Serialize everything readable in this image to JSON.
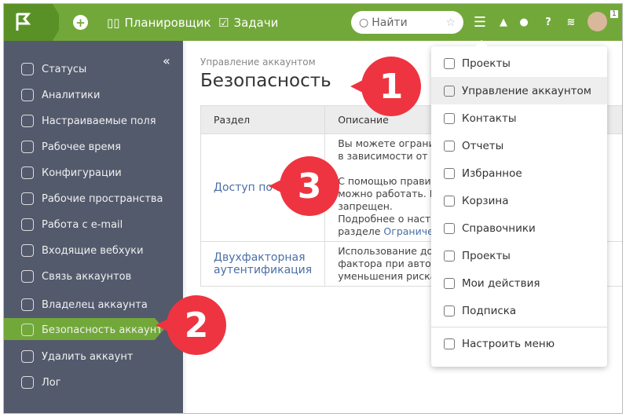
{
  "topbar": {
    "planner": "Планировщик",
    "tasks": "Задачи",
    "search_placeholder": "Найти",
    "notif_count": "1"
  },
  "sidebar": {
    "collapse": "«",
    "items": [
      {
        "label": "Статусы"
      },
      {
        "label": "Аналитики"
      },
      {
        "label": "Настраиваемые поля"
      },
      {
        "label": "Рабочее время"
      },
      {
        "label": "Конфигурации"
      },
      {
        "label": "Рабочие пространства"
      },
      {
        "label": "Работа с e-mail"
      },
      {
        "label": "Входящие вебхуки"
      },
      {
        "label": "Связь аккаунтов"
      },
      {
        "label": "Владелец аккаунта"
      },
      {
        "label": "Безопасность аккаунта"
      },
      {
        "label": "Удалить аккаунт"
      },
      {
        "label": "Лог"
      }
    ]
  },
  "main": {
    "breadcrumb": "Управление аккаунтом",
    "title": "Безопасность",
    "col_section": "Раздел",
    "col_desc": "Описание",
    "rows": [
      {
        "section": "Доступ по IP",
        "desc1": "Вы можете огранич",
        "desc2": "в зависимости от их",
        "desc3": "С помощью правил",
        "desc4": "можно работать. Вс",
        "desc5": "запрещен.",
        "desc6": "Подробнее о настро",
        "desc7": "разделе ",
        "link": "Ограничени"
      },
      {
        "section": "Двухфакторная аутентификация",
        "desc1": "Использование доп",
        "desc2": "фактора при автори",
        "desc3": "уменьшения риска"
      }
    ]
  },
  "menu": {
    "items": [
      {
        "label": "Проекты"
      },
      {
        "label": "Управление аккаунтом"
      },
      {
        "label": "Контакты"
      },
      {
        "label": "Отчеты"
      },
      {
        "label": "Избранное"
      },
      {
        "label": "Корзина"
      },
      {
        "label": "Справочники"
      },
      {
        "label": "Проекты"
      },
      {
        "label": "Мои действия"
      },
      {
        "label": "Подписка"
      },
      {
        "label": "Настроить меню"
      }
    ]
  },
  "badges": [
    "1",
    "2",
    "3"
  ]
}
